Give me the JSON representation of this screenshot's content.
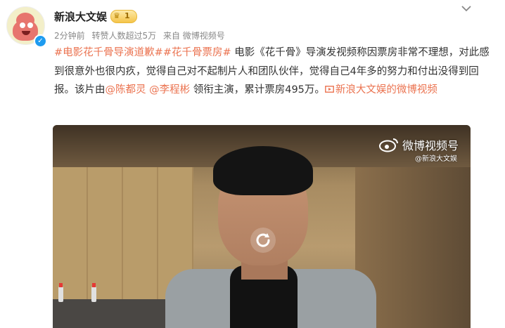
{
  "user": {
    "name": "新浪大文娱",
    "vip_level": "1"
  },
  "meta": {
    "time": "2分钟前",
    "reposts": "转赞人数超过5万",
    "source": "来自 微博视频号"
  },
  "post": {
    "tag1": "#电影花千骨导演道歉#",
    "tag2": "#花千骨票房#",
    "text1": "电影《花千骨》导演发视频称因票房非常不理想，对此感到很意外也很内疚，觉得自己对不起制片人和团队伙伴，觉得自己4年多的努力和付出没得到回报。该片由",
    "mention1": "@陈都灵",
    "mention2": "@李程彬",
    "text2": "领衔主演，累计票房495万。",
    "video_link": "新浪大文娱的微博视频"
  },
  "video": {
    "watermark": "微博视频号",
    "watermark_sub": "@新浪大文娱"
  },
  "colors": {
    "link": "#eb7350",
    "meta": "#888888"
  },
  "icons": {
    "verified": "verified-badge-icon",
    "chevron": "chevron-down-icon",
    "video_link": "video-link-icon",
    "watermark": "weibo-logo-icon",
    "replay": "replay-icon"
  }
}
